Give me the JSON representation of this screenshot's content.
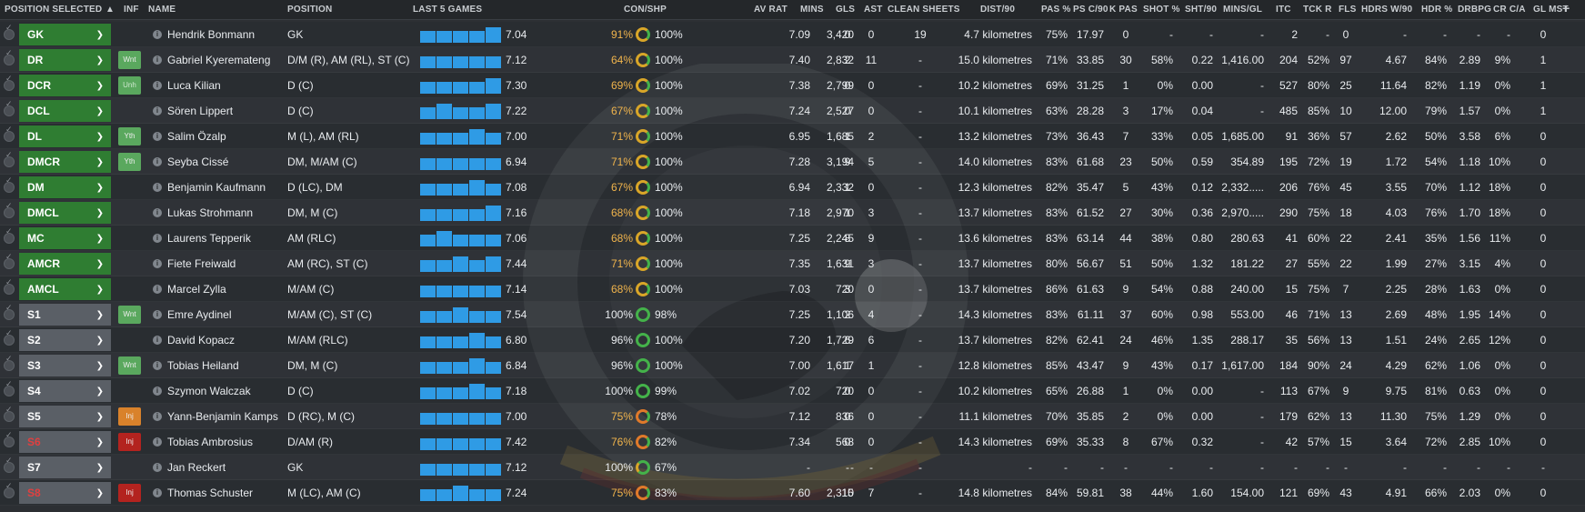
{
  "header": {
    "position_selected": "POSITION SELECTED",
    "inf": "INF",
    "name": "NAME",
    "position": "POSITION",
    "last5": "LAST 5 GAMES",
    "con_shp": "CON/SHP",
    "av_rat": "AV RAT",
    "mins": "MINS",
    "gls": "GLS",
    "ast": "AST",
    "clean_sheets": "CLEAN SHEETS",
    "dist90": "DIST/90",
    "pas": "PAS %",
    "psc90": "PS C/90",
    "kpas": "K PAS",
    "shot": "SHOT %",
    "sht90": "SHT/90",
    "minsgl": "MINS/GL",
    "itc": "ITC",
    "tckr": "TCK R",
    "fls": "FLS",
    "hdrs90": "HDRS W/90",
    "hdr": "HDR %",
    "drbpg": "DRBPG",
    "crca": "CR C/A",
    "glmst": "GL MST",
    "add": "+"
  },
  "rows": [
    {
      "pos": "GK",
      "box": "green",
      "inf": "",
      "name": "Hendrik Bonmann",
      "position": "GK",
      "bars": [
        10,
        10,
        10,
        12,
        13
      ],
      "last": "7.04",
      "con": "91%",
      "shp": "100%",
      "ring": "yellow",
      "avrat": "7.09",
      "mins": "3,420",
      "gls": "0",
      "ast": "0",
      "cs": "19",
      "dist": "4.7 kilometres",
      "pas": "75%",
      "psc": "17.97",
      "kpas": "0",
      "shot": "-",
      "sht": "-",
      "minsgl": "-",
      "itc": "2",
      "tckr": "-",
      "fls": "0",
      "hdrs": "-",
      "hdr": "-",
      "drbpg": "-",
      "crca": "-",
      "glmst": "0"
    },
    {
      "pos": "DR",
      "box": "green",
      "inf": "Wnt",
      "inf_class": "wnt",
      "name": "Gabriel Kyeremateng",
      "position": "D/M (R), AM (RL), ST (C)",
      "bars": [
        10,
        10,
        10,
        10,
        10
      ],
      "last": "7.12",
      "con": "64%",
      "shp": "100%",
      "ring": "yellow",
      "avrat": "7.40",
      "mins": "2,832",
      "gls": "2",
      "ast": "11",
      "cs": "-",
      "dist": "15.0 kilometres",
      "pas": "71%",
      "psc": "33.85",
      "kpas": "30",
      "shot": "58%",
      "sht": "0.22",
      "minsgl": "1,416.00",
      "itc": "204",
      "tckr": "52%",
      "fls": "97",
      "hdrs": "4.67",
      "hdr": "84%",
      "drbpg": "2.89",
      "crca": "9%",
      "glmst": "1"
    },
    {
      "pos": "DCR",
      "box": "green",
      "inf": "Unh",
      "inf_class": "urh",
      "name": "Luca Kilian",
      "position": "D (C)",
      "bars": [
        10,
        10,
        10,
        10,
        13
      ],
      "last": "7.30",
      "con": "69%",
      "shp": "100%",
      "ring": "yellow",
      "avrat": "7.38",
      "mins": "2,799",
      "gls": "0",
      "ast": "0",
      "cs": "-",
      "dist": "10.2 kilometres",
      "pas": "69%",
      "psc": "31.25",
      "kpas": "1",
      "shot": "0%",
      "sht": "0.00",
      "minsgl": "-",
      "itc": "527",
      "tckr": "80%",
      "fls": "25",
      "hdrs": "11.64",
      "hdr": "82%",
      "drbpg": "1.19",
      "crca": "0%",
      "glmst": "1"
    },
    {
      "pos": "DCL",
      "box": "green",
      "inf": "",
      "name": "Sören Lippert",
      "position": "D (C)",
      "bars": [
        10,
        13,
        10,
        10,
        13
      ],
      "last": "7.22",
      "con": "67%",
      "shp": "100%",
      "ring": "yellow",
      "avrat": "7.24",
      "mins": "2,527",
      "gls": "0",
      "ast": "0",
      "cs": "-",
      "dist": "10.1 kilometres",
      "pas": "63%",
      "psc": "28.28",
      "kpas": "3",
      "shot": "17%",
      "sht": "0.04",
      "minsgl": "-",
      "itc": "485",
      "tckr": "85%",
      "fls": "10",
      "hdrs": "12.00",
      "hdr": "79%",
      "drbpg": "1.57",
      "crca": "0%",
      "glmst": "1"
    },
    {
      "pos": "DL",
      "box": "green",
      "inf": "Yth",
      "inf_class": "yth",
      "name": "Salim Özalp",
      "position": "M (L), AM (RL)",
      "bars": [
        10,
        10,
        10,
        13,
        10
      ],
      "last": "7.00",
      "con": "71%",
      "shp": "100%",
      "ring": "yellow",
      "avrat": "6.95",
      "mins": "1,685",
      "gls": "1",
      "ast": "2",
      "cs": "-",
      "dist": "13.2 kilometres",
      "pas": "73%",
      "psc": "36.43",
      "kpas": "7",
      "shot": "33%",
      "sht": "0.05",
      "minsgl": "1,685.00",
      "itc": "91",
      "tckr": "36%",
      "fls": "57",
      "hdrs": "2.62",
      "hdr": "50%",
      "drbpg": "3.58",
      "crca": "6%",
      "glmst": "0"
    },
    {
      "pos": "DMCR",
      "box": "green",
      "inf": "Yth",
      "inf_class": "yth",
      "name": "Seyba Cissé",
      "position": "DM, M/AM (C)",
      "bars": [
        10,
        10,
        10,
        10,
        10
      ],
      "last": "6.94",
      "con": "71%",
      "shp": "100%",
      "ring": "yellow",
      "avrat": "7.28",
      "mins": "3,194",
      "gls": "9",
      "ast": "5",
      "cs": "-",
      "dist": "14.0 kilometres",
      "pas": "83%",
      "psc": "61.68",
      "kpas": "23",
      "shot": "50%",
      "sht": "0.59",
      "minsgl": "354.89",
      "itc": "195",
      "tckr": "72%",
      "fls": "19",
      "hdrs": "1.72",
      "hdr": "54%",
      "drbpg": "1.18",
      "crca": "10%",
      "glmst": "0"
    },
    {
      "pos": "DM",
      "box": "green",
      "inf": "",
      "name": "Benjamin Kaufmann",
      "position": "D (LC), DM",
      "bars": [
        10,
        10,
        10,
        13,
        10
      ],
      "last": "7.08",
      "con": "67%",
      "shp": "100%",
      "ring": "yellow",
      "avrat": "6.94",
      "mins": "2,332",
      "gls": "1",
      "ast": "0",
      "cs": "-",
      "dist": "12.3 kilometres",
      "pas": "82%",
      "psc": "35.47",
      "kpas": "5",
      "shot": "43%",
      "sht": "0.12",
      "minsgl": "2,332.....",
      "itc": "206",
      "tckr": "76%",
      "fls": "45",
      "hdrs": "3.55",
      "hdr": "70%",
      "drbpg": "1.12",
      "crca": "18%",
      "glmst": "0"
    },
    {
      "pos": "DMCL",
      "box": "green",
      "inf": "",
      "name": "Lukas Strohmann",
      "position": "DM, M (C)",
      "bars": [
        10,
        10,
        10,
        10,
        13
      ],
      "last": "7.16",
      "con": "68%",
      "shp": "100%",
      "ring": "yellow",
      "avrat": "7.18",
      "mins": "2,970",
      "gls": "1",
      "ast": "3",
      "cs": "-",
      "dist": "13.7 kilometres",
      "pas": "83%",
      "psc": "61.52",
      "kpas": "27",
      "shot": "30%",
      "sht": "0.36",
      "minsgl": "2,970.....",
      "itc": "290",
      "tckr": "75%",
      "fls": "18",
      "hdrs": "4.03",
      "hdr": "76%",
      "drbpg": "1.70",
      "crca": "18%",
      "glmst": "0"
    },
    {
      "pos": "MC",
      "box": "green",
      "inf": "",
      "name": "Laurens Tepperik",
      "position": "AM (RLC)",
      "bars": [
        10,
        13,
        10,
        10,
        10
      ],
      "last": "7.06",
      "con": "68%",
      "shp": "100%",
      "ring": "yellow",
      "avrat": "7.25",
      "mins": "2,245",
      "gls": "8",
      "ast": "9",
      "cs": "-",
      "dist": "13.6 kilometres",
      "pas": "83%",
      "psc": "63.14",
      "kpas": "44",
      "shot": "38%",
      "sht": "0.80",
      "minsgl": "280.63",
      "itc": "41",
      "tckr": "60%",
      "fls": "22",
      "hdrs": "2.41",
      "hdr": "35%",
      "drbpg": "1.56",
      "crca": "11%",
      "glmst": "0"
    },
    {
      "pos": "AMCR",
      "box": "green",
      "inf": "",
      "name": "Fiete Freiwald",
      "position": "AM (RC), ST (C)",
      "bars": [
        10,
        10,
        13,
        10,
        13
      ],
      "last": "7.44",
      "con": "71%",
      "shp": "100%",
      "ring": "yellow",
      "avrat": "7.35",
      "mins": "1,631",
      "gls": "9",
      "ast": "3",
      "cs": "-",
      "dist": "13.7 kilometres",
      "pas": "80%",
      "psc": "56.67",
      "kpas": "51",
      "shot": "50%",
      "sht": "1.32",
      "minsgl": "181.22",
      "itc": "27",
      "tckr": "55%",
      "fls": "22",
      "hdrs": "1.99",
      "hdr": "27%",
      "drbpg": "3.15",
      "crca": "4%",
      "glmst": "0"
    },
    {
      "pos": "AMCL",
      "box": "green",
      "inf": "",
      "name": "Marcel Zylla",
      "position": "M/AM (C)",
      "bars": [
        10,
        10,
        10,
        10,
        10
      ],
      "last": "7.14",
      "con": "68%",
      "shp": "100%",
      "ring": "yellow",
      "avrat": "7.03",
      "mins": "720",
      "gls": "3",
      "ast": "0",
      "cs": "-",
      "dist": "13.7 kilometres",
      "pas": "86%",
      "psc": "61.63",
      "kpas": "9",
      "shot": "54%",
      "sht": "0.88",
      "minsgl": "240.00",
      "itc": "15",
      "tckr": "75%",
      "fls": "7",
      "hdrs": "2.25",
      "hdr": "28%",
      "drbpg": "1.63",
      "crca": "0%",
      "glmst": "0"
    },
    {
      "pos": "S1",
      "box": "grey",
      "inf": "Wnt",
      "inf_class": "wnt",
      "name": "Emre Aydinel",
      "position": "M/AM (C), ST (C)",
      "bars": [
        10,
        10,
        13,
        10,
        10
      ],
      "last": "7.54",
      "con": "100%",
      "con_white": true,
      "shp": "98%",
      "ring": "green",
      "avrat": "7.25",
      "mins": "1,106",
      "gls": "2",
      "ast": "4",
      "cs": "-",
      "dist": "14.3 kilometres",
      "pas": "83%",
      "psc": "61.11",
      "kpas": "37",
      "shot": "60%",
      "sht": "0.98",
      "minsgl": "553.00",
      "itc": "46",
      "tckr": "71%",
      "fls": "13",
      "hdrs": "2.69",
      "hdr": "48%",
      "drbpg": "1.95",
      "crca": "14%",
      "glmst": "0"
    },
    {
      "pos": "S2",
      "box": "grey",
      "inf": "",
      "name": "David Kopacz",
      "position": "M/AM (RLC)",
      "bars": [
        10,
        10,
        10,
        13,
        10
      ],
      "last": "6.80",
      "con": "96%",
      "con_white": true,
      "shp": "100%",
      "ring": "green",
      "avrat": "7.20",
      "mins": "1,729",
      "gls": "6",
      "ast": "6",
      "cs": "-",
      "dist": "13.7 kilometres",
      "pas": "82%",
      "psc": "62.41",
      "kpas": "24",
      "shot": "46%",
      "sht": "1.35",
      "minsgl": "288.17",
      "itc": "35",
      "tckr": "56%",
      "fls": "13",
      "hdrs": "1.51",
      "hdr": "24%",
      "drbpg": "2.65",
      "crca": "12%",
      "glmst": "0"
    },
    {
      "pos": "S3",
      "box": "grey",
      "inf": "Wnt",
      "inf_class": "wnt",
      "name": "Tobias Heiland",
      "position": "DM, M (C)",
      "bars": [
        10,
        10,
        10,
        13,
        10
      ],
      "last": "6.84",
      "con": "96%",
      "con_white": true,
      "shp": "100%",
      "ring": "green",
      "avrat": "7.00",
      "mins": "1,617",
      "gls": "1",
      "ast": "1",
      "cs": "-",
      "dist": "12.8 kilometres",
      "pas": "85%",
      "psc": "43.47",
      "kpas": "9",
      "shot": "43%",
      "sht": "0.17",
      "minsgl": "1,617.00",
      "itc": "184",
      "tckr": "90%",
      "fls": "24",
      "hdrs": "4.29",
      "hdr": "62%",
      "drbpg": "1.06",
      "crca": "0%",
      "glmst": "0"
    },
    {
      "pos": "S4",
      "box": "grey",
      "inf": "",
      "name": "Szymon Walczak",
      "position": "D (C)",
      "bars": [
        10,
        10,
        10,
        13,
        10
      ],
      "last": "7.18",
      "con": "100%",
      "con_white": true,
      "shp": "99%",
      "ring": "green",
      "avrat": "7.02",
      "mins": "720",
      "gls": "0",
      "ast": "0",
      "cs": "-",
      "dist": "10.2 kilometres",
      "pas": "65%",
      "psc": "26.88",
      "kpas": "1",
      "shot": "0%",
      "sht": "0.00",
      "minsgl": "-",
      "itc": "113",
      "tckr": "67%",
      "fls": "9",
      "hdrs": "9.75",
      "hdr": "81%",
      "drbpg": "0.63",
      "crca": "0%",
      "glmst": "0"
    },
    {
      "pos": "S5",
      "box": "grey",
      "inf": "Inj",
      "inf_class": "inj-o",
      "name": "Yann-Benjamin Kamps",
      "position": "D (RC), M (C)",
      "bars": [
        10,
        10,
        10,
        10,
        10
      ],
      "last": "7.00",
      "con": "75%",
      "shp": "78%",
      "ring": "orange",
      "avrat": "7.12",
      "mins": "836",
      "gls": "0",
      "ast": "0",
      "cs": "-",
      "dist": "11.1 kilometres",
      "pas": "70%",
      "psc": "35.85",
      "kpas": "2",
      "shot": "0%",
      "sht": "0.00",
      "minsgl": "-",
      "itc": "179",
      "tckr": "62%",
      "fls": "13",
      "hdrs": "11.30",
      "hdr": "75%",
      "drbpg": "1.29",
      "crca": "0%",
      "glmst": "0"
    },
    {
      "pos": "S6",
      "box": "grey",
      "pos_red": true,
      "inf": "Inj",
      "inf_class": "inj-r",
      "name": "Tobias Ambrosius",
      "position": "D/AM (R)",
      "bars": [
        10,
        10,
        10,
        10,
        10
      ],
      "last": "7.42",
      "con": "76%",
      "shp": "82%",
      "ring": "orange",
      "avrat": "7.34",
      "mins": "568",
      "gls": "0",
      "ast": "0",
      "cs": "-",
      "dist": "14.3 kilometres",
      "pas": "69%",
      "psc": "35.33",
      "kpas": "8",
      "shot": "67%",
      "sht": "0.32",
      "minsgl": "-",
      "itc": "42",
      "tckr": "57%",
      "fls": "15",
      "hdrs": "3.64",
      "hdr": "72%",
      "drbpg": "2.85",
      "crca": "10%",
      "glmst": "0"
    },
    {
      "pos": "S7",
      "box": "grey",
      "inf": "",
      "name": "Jan Reckert",
      "position": "GK",
      "bars": [
        10,
        10,
        10,
        10,
        10
      ],
      "last": "7.12",
      "con": "100%",
      "con_white": true,
      "shp": "67%",
      "ring": "green-part",
      "avrat": "-",
      "mins": "-",
      "gls": "-",
      "ast": "-",
      "cs": "-",
      "dist": "-",
      "pas": "-",
      "psc": "-",
      "kpas": "-",
      "shot": "-",
      "sht": "-",
      "minsgl": "-",
      "itc": "-",
      "tckr": "-",
      "fls": "-",
      "hdrs": "-",
      "hdr": "-",
      "drbpg": "-",
      "crca": "-",
      "glmst": "-"
    },
    {
      "pos": "S8",
      "box": "grey",
      "pos_red": true,
      "inf": "Inj",
      "inf_class": "inj-r",
      "name": "Thomas Schuster",
      "position": "M (LC), AM (C)",
      "bars": [
        10,
        10,
        13,
        10,
        10
      ],
      "last": "7.24",
      "con": "75%",
      "shp": "83%",
      "ring": "orange",
      "avrat": "7.60",
      "mins": "2,310",
      "gls": "15",
      "ast": "7",
      "cs": "-",
      "dist": "14.8 kilometres",
      "pas": "84%",
      "psc": "59.81",
      "kpas": "38",
      "shot": "44%",
      "sht": "1.60",
      "minsgl": "154.00",
      "itc": "121",
      "tckr": "69%",
      "fls": "43",
      "hdrs": "4.91",
      "hdr": "66%",
      "drbpg": "2.03",
      "crca": "0%",
      "glmst": "0"
    }
  ]
}
